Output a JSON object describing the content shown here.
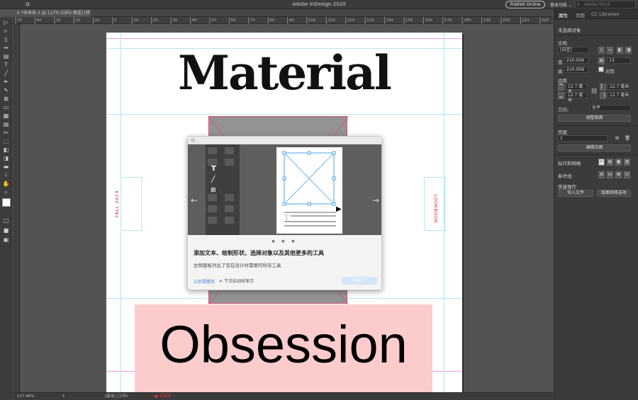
{
  "app": {
    "title": "Adobe InDesign 2020",
    "publish_label": "Publish Online",
    "workspace_label": "基本功能 ⌄",
    "search_placeholder": "Adobe Stock",
    "doc_tab": "*未命名-1 @ 117% [GPU 预览] [转换]",
    "doc_tab_close": "×"
  },
  "rulers": {
    "top_ticks": [
      "50",
      "40",
      "30",
      "20",
      "10",
      "0",
      "10",
      "20",
      "30",
      "40",
      "50",
      "60",
      "70",
      "80",
      "90",
      "100",
      "110",
      "120",
      "130",
      "140",
      "150",
      "160",
      "170",
      "180",
      "190",
      "200",
      "210",
      "220"
    ]
  },
  "document": {
    "title_text": "Material",
    "left_vertical_text": "FALL 2019",
    "right_vertical_text": "LOOKBOOK",
    "bottom_text": "Obsession"
  },
  "statusbar": {
    "zoom": "117.46%",
    "page": "1",
    "mode": "[基本] (工作)",
    "errors": "● 无错误"
  },
  "panel": {
    "tabs": [
      "属性",
      "页面",
      "CC Libraries"
    ],
    "active_tab": "属性",
    "no_selection": "未选择对象",
    "doc_section": "文档",
    "preset_value": "[自定]",
    "width_label": "宽",
    "width_value": "210.058",
    "pages_value": "13",
    "height_label": "高",
    "height_value": "210.058",
    "facing_label": "对页",
    "margin_section": "边距",
    "margin_top": "12.7 毫米",
    "margin_bottom": "12.7 毫米",
    "margin_inside": "12.7 毫米",
    "margin_outside": "12.7 毫米",
    "direction_label": "方向:",
    "direction_value": "水平",
    "adjust_layout": "调整版面",
    "pages_section": "页面",
    "page_select_value": "1",
    "edit_page": "编辑页面",
    "ruler_grid_section": "标尺和网格",
    "guides_section": "参考线",
    "quick_actions_section": "快速操作",
    "import_file": "导入文件",
    "page_grid_options": "版面网格选项"
  },
  "modal": {
    "heading": "添加文本、绘制形状、选择对象以及其他更多的工具",
    "subtext": "左侧面板列出了您在设计时需要的所有工具",
    "dismiss_link": "以后提醒我",
    "checkbox_label": "下次启动时显示",
    "next_button": "知道了",
    "dots": "● ● ●",
    "prev_arrow": "←",
    "next_arrow": "→"
  },
  "colors": {
    "pink_box": "#fccccc",
    "guide_cyan": "#b6e7f3",
    "guide_magenta": "#ef9ddf",
    "frame_red": "#d64c7a",
    "selection_blue": "#4aa3e6"
  }
}
